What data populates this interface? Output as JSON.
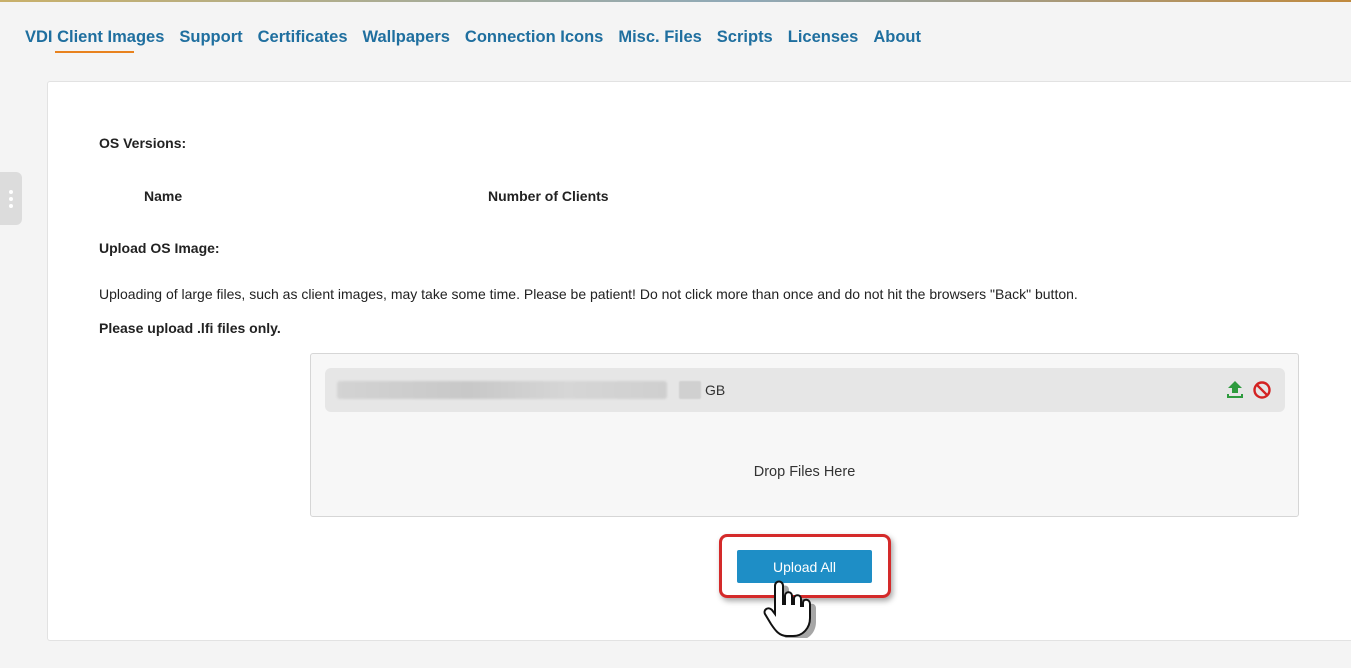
{
  "nav": {
    "tabs": [
      {
        "label": "VDI Client Images",
        "active": true
      },
      {
        "label": "Support"
      },
      {
        "label": "Certificates"
      },
      {
        "label": "Wallpapers"
      },
      {
        "label": "Connection Icons"
      },
      {
        "label": "Misc. Files"
      },
      {
        "label": "Scripts"
      },
      {
        "label": "Licenses"
      },
      {
        "label": "About"
      }
    ]
  },
  "os_versions": {
    "heading": "OS Versions:",
    "columns": [
      "Name",
      "Number of Clients"
    ]
  },
  "upload": {
    "heading": "Upload OS Image:",
    "notice": "Uploading of large files, such as client images, may take some time. Please be patient! Do not click more than once and do not hit the browsers \"Back\" button.",
    "file_type_note": "Please upload .lfi files only.",
    "file": {
      "size_unit": "GB"
    },
    "drop_text": "Drop Files Here",
    "upload_all_label": "Upload All"
  },
  "colors": {
    "nav_text": "#1f6f9f",
    "active_underline": "#e8821e",
    "button": "#1e8ec6",
    "highlight": "#d42a2a",
    "upload_icon": "#2e9b3e",
    "cancel_icon": "#d32222"
  },
  "icons": {
    "file_upload": "upload-icon",
    "file_cancel": "cancel-icon",
    "side_handle": "drag-handle-icon",
    "pointer": "hand-pointer-cursor-icon"
  }
}
